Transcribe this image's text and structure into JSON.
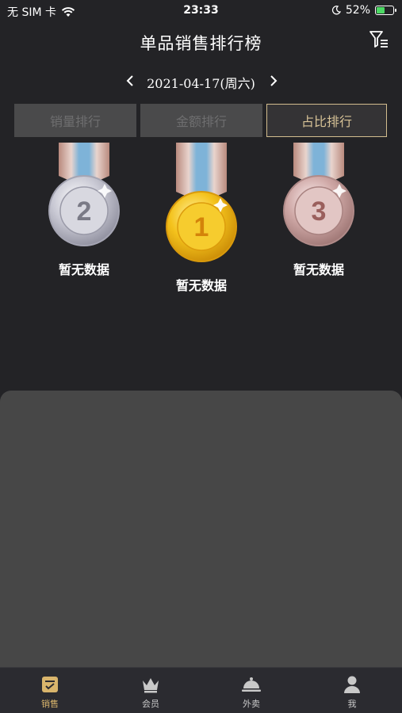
{
  "status_bar": {
    "carrier": "无 SIM 卡",
    "time": "23:33",
    "battery_percent": "52%",
    "battery_level": 0.52
  },
  "nav": {
    "title": "单品销售排行榜"
  },
  "date_picker": {
    "date": "2021-04-17(周六)"
  },
  "tabs": [
    {
      "label": "销量排行",
      "selected": false
    },
    {
      "label": "金额排行",
      "selected": false
    },
    {
      "label": "占比排行",
      "selected": true
    }
  ],
  "podium": [
    {
      "rank": "2",
      "label": "暂无数据",
      "tone": "silver"
    },
    {
      "rank": "1",
      "label": "暂无数据",
      "tone": "gold"
    },
    {
      "rank": "3",
      "label": "暂无数据",
      "tone": "bronze"
    }
  ],
  "tab_bar": [
    {
      "label": "销售",
      "icon": "sales-icon",
      "active": true
    },
    {
      "label": "会员",
      "icon": "crown-icon",
      "active": false
    },
    {
      "label": "外卖",
      "icon": "food-cover-icon",
      "active": false
    },
    {
      "label": "我",
      "icon": "user-icon",
      "active": false
    }
  ],
  "colors": {
    "background": "#232326",
    "accent": "#d9b56c",
    "panel": "#474747"
  }
}
